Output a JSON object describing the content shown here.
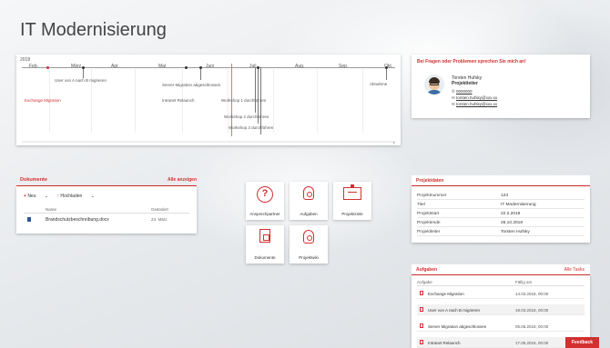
{
  "page": {
    "title": "IT Modernisierung"
  },
  "timeline": {
    "year": "2018",
    "months": [
      "Feb.",
      "März",
      "Apr.",
      "Mai",
      "Juni",
      "Juli",
      "Aug.",
      "Sep.",
      "Okt."
    ],
    "events": [
      "User von A nach B migrieren",
      "Server Migration abgeschlossen",
      "Exchange Migration",
      "Intranet Relaunch",
      "Workshop 1 durchführen",
      "Workshop 2 durchführen",
      "Workshop 3 durchführen",
      "Abnahme"
    ]
  },
  "contact": {
    "heading": "Bei Fragen oder Problemen sprechen Sie mich an!",
    "name": "Torsten Hufsky",
    "role": "Projektleiter",
    "phone": "0000000",
    "email1": "torsten.hufsky@xxx.xx",
    "email2": "torsten.hufsky@xxx.xx"
  },
  "documents": {
    "title": "Dokumente",
    "show_all": "Alle anzeigen",
    "new": "Neu",
    "upload": "Hochladen",
    "col_name": "Name",
    "col_changed": "Geändert",
    "rows": [
      {
        "name": "Brandschutzbeschreibung.docx",
        "changed": "23. März"
      }
    ]
  },
  "tiles": [
    "Ansprechpartner",
    "Aufgaben",
    "Projektziele",
    "Dokumente",
    "Projektwiki"
  ],
  "project_data": {
    "title": "Projektdaten",
    "rows": [
      {
        "k": "Projektnummer",
        "v": "123"
      },
      {
        "k": "Titel",
        "v": "IT Modernisierung"
      },
      {
        "k": "Projektstart",
        "v": "22.2.2018"
      },
      {
        "k": "Projektende",
        "v": "26.10.2018"
      },
      {
        "k": "Projektleiter",
        "v": "Torsten Hufsky"
      }
    ]
  },
  "tasks": {
    "title": "Aufgaben",
    "all": "Alle Tasks",
    "col_task": "Aufgabe",
    "col_due": "Fällig am",
    "rows": [
      {
        "name": "Exchange Migration",
        "due": "14.03.2018, 00:00"
      },
      {
        "name": "User von A nach B migrieren",
        "due": "19.03.2018, 00:00"
      },
      {
        "name": "Server Migration abgeschlossen",
        "due": "05.06.2018, 00:00"
      },
      {
        "name": "Intranet Relaunch",
        "due": "17.05.2018, 00:00"
      }
    ]
  },
  "feedback": "Feedback",
  "colors": {
    "accent": "#d32f2f"
  }
}
